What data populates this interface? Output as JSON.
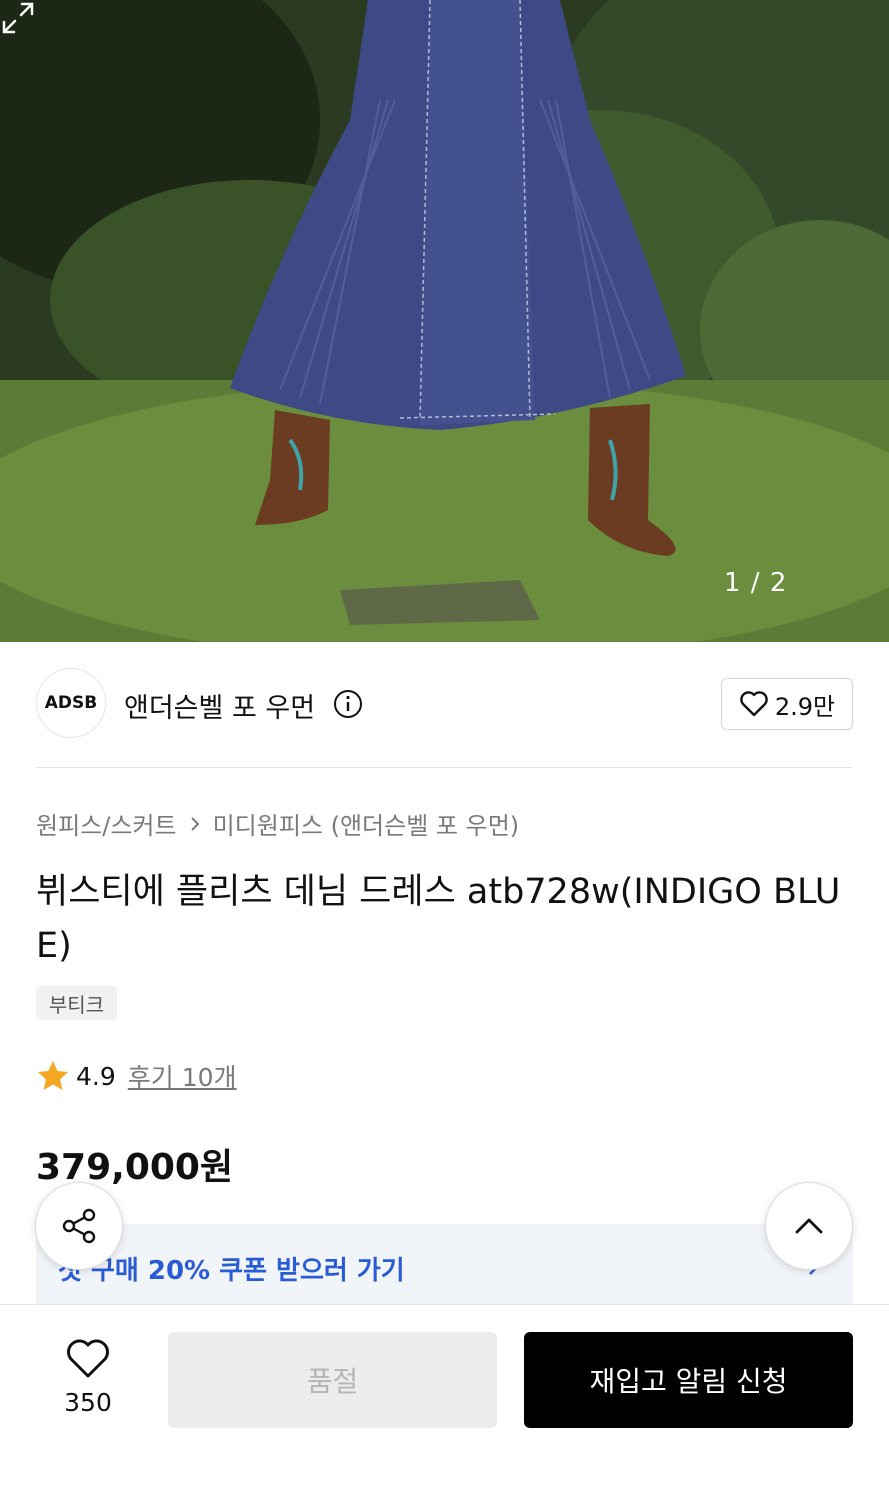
{
  "gallery": {
    "counter": "1 / 2"
  },
  "brand": {
    "logo_text": "ADSB",
    "name": "앤더슨벨 포 우먼",
    "like_count": "2.9만"
  },
  "breadcrumb": {
    "category": "원피스/스커트",
    "subcategory": "미디원피스 (앤더슨벨 포 우먼)"
  },
  "product": {
    "title": "뷔스티에 플리츠 데님 드레스 atb728w(INDIGO BLUE)",
    "tag": "부티크",
    "rating": "4.9",
    "review_link": "후기 10개",
    "price": "379,000원"
  },
  "coupon": {
    "text": "첫 구매 20% 쿠폰 받으러 가기"
  },
  "bottom_bar": {
    "wish_count": "350",
    "soldout_label": "품절",
    "restock_label": "재입고 알림 신청"
  },
  "colors": {
    "accent_blue": "#2a5bd7",
    "star": "#f5a623",
    "primary_button": "#000000"
  }
}
